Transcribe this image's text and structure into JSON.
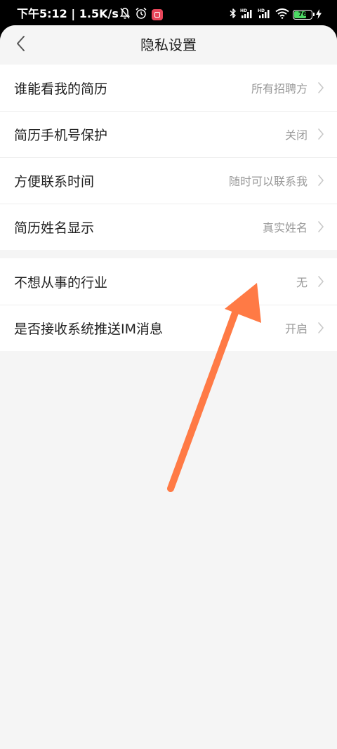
{
  "status_bar": {
    "time_text": "下午5:12 | 1.5K/s",
    "battery_level": "76",
    "battery_fraction": 0.76,
    "icons": [
      "mute-bell-icon",
      "alarm-icon",
      "app-badge-icon",
      "bluetooth-icon",
      "hd-signal-icon",
      "hd-signal-icon",
      "wifi-icon",
      "battery-icon",
      "charging-bolt-icon"
    ],
    "badge_color": "#e8465a",
    "battery_color": "#4cd964"
  },
  "header": {
    "back_icon": "chevron-left-icon",
    "title": "隐私设置"
  },
  "groups": [
    {
      "items": [
        {
          "label": "谁能看我的简历",
          "value": "所有招聘方"
        },
        {
          "label": "简历手机号保护",
          "value": "关闭"
        },
        {
          "label": "方便联系时间",
          "value": "随时可以联系我"
        },
        {
          "label": "简历姓名显示",
          "value": "真实姓名"
        }
      ]
    },
    {
      "items": [
        {
          "label": "不想从事的行业",
          "value": "无"
        },
        {
          "label": "是否接收系统推送IM消息",
          "value": "开启"
        }
      ]
    }
  ],
  "annotation": {
    "type": "arrow",
    "color": "#ff7a45"
  }
}
